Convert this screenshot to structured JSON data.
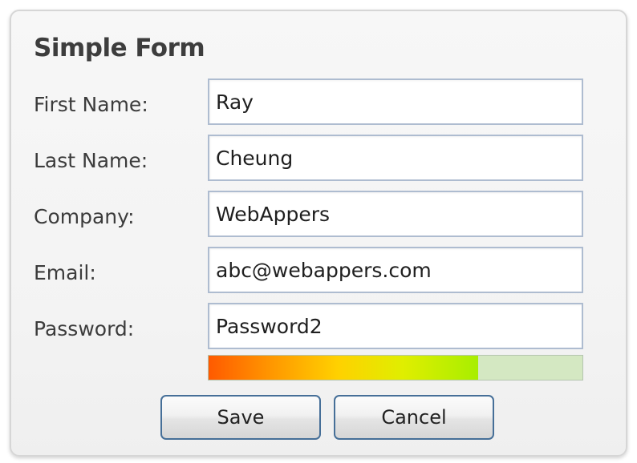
{
  "form": {
    "title": "Simple Form",
    "fields": [
      {
        "label": "First Name:",
        "value": "Ray"
      },
      {
        "label": "Last Name:",
        "value": "Cheung"
      },
      {
        "label": "Company:",
        "value": "WebAppers"
      },
      {
        "label": "Email:",
        "value": "abc@webappers.com"
      },
      {
        "label": "Password:",
        "value": "Password2"
      }
    ],
    "password_strength": 0.72,
    "buttons": {
      "save_label": "Save",
      "cancel_label": "Cancel"
    }
  }
}
